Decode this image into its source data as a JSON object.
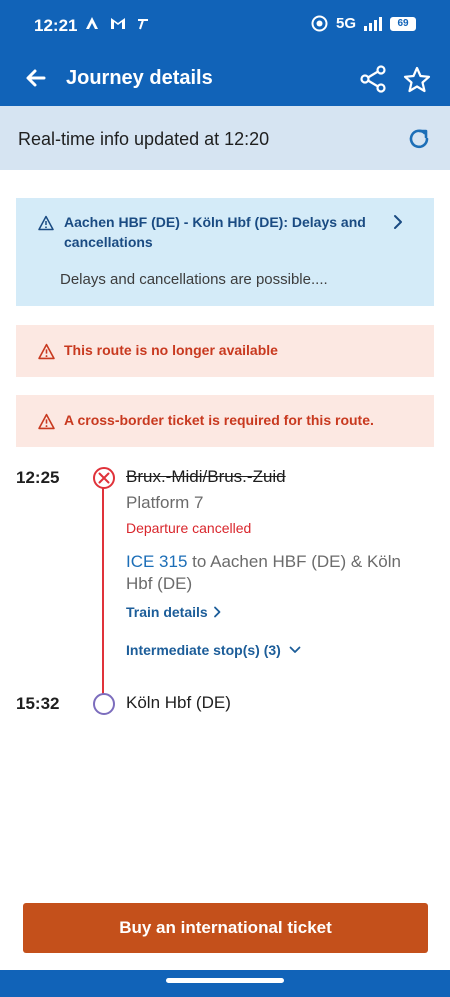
{
  "status_bar": {
    "time": "12:21",
    "network": "5G",
    "battery": "69",
    "icons": [
      "app-a-icon",
      "gmail-icon",
      "hash-icon",
      "whatsapp-icon",
      "signal-icon",
      "battery-icon"
    ]
  },
  "app_bar": {
    "title": "Journey details",
    "icons": [
      "back-arrow-icon",
      "share-icon",
      "star-icon"
    ]
  },
  "realtime": {
    "text": "Real-time info updated at 12:20",
    "icon": "refresh-icon"
  },
  "notice": {
    "title": "Aachen HBF (DE) - Köln Hbf (DE): Delays and cancellations",
    "body": "Delays and cancellations are possible...."
  },
  "alerts": [
    {
      "text": "This route is no longer available"
    },
    {
      "text": "A cross-border ticket is required for this route."
    }
  ],
  "journey": {
    "departure": {
      "time": "12:25",
      "station": "Brux.-Midi/Brus.-Zuid",
      "platform": "Platform 7",
      "status": "Departure cancelled"
    },
    "train": {
      "number": "ICE 315",
      "destination": " to Aachen HBF (DE) & Köln Hbf (DE)"
    },
    "train_details_label": "Train details",
    "intermediate_label": "Intermediate stop(s) (3)",
    "arrival": {
      "time": "15:32",
      "station": "Köln Hbf (DE)"
    }
  },
  "buy_button": "Buy an international ticket",
  "colors": {
    "brand_blue": "#1163b8",
    "alert_red": "#c8391f",
    "cancel_red": "#d9262c",
    "buy_orange": "#c4501b"
  }
}
